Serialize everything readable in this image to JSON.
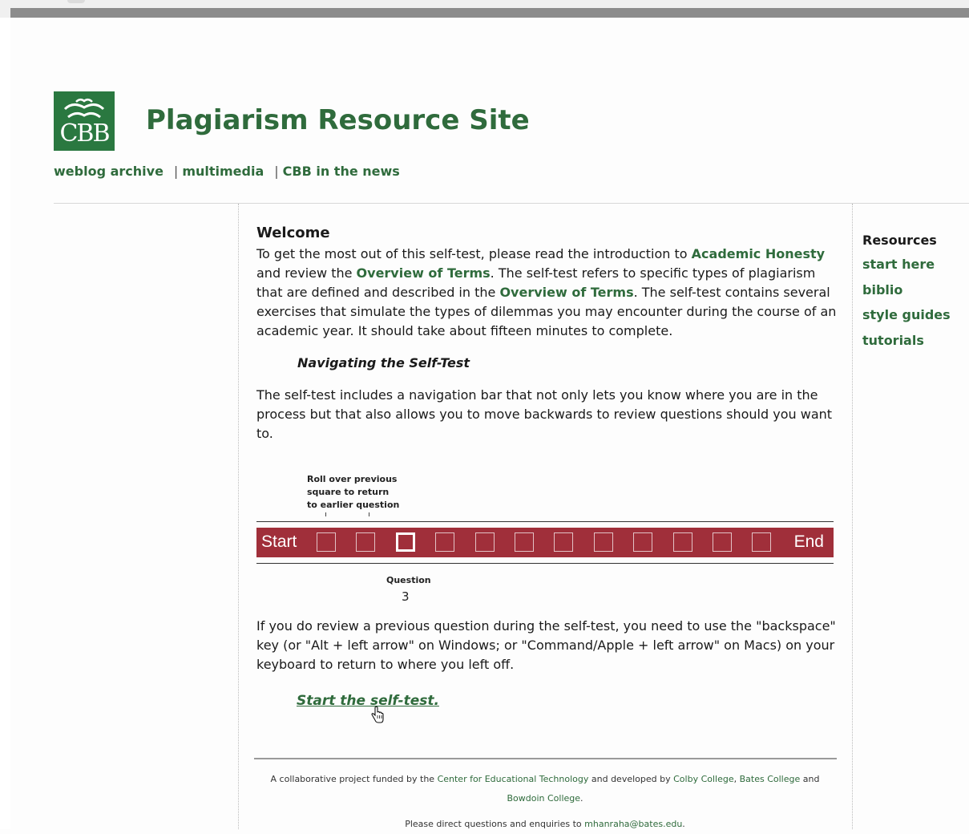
{
  "site": {
    "logo_text": "CBB",
    "title": "Plagiarism Resource Site",
    "nav": [
      "weblog archive",
      "multimedia",
      "CBB in the news"
    ],
    "nav_separator": "|"
  },
  "welcome": {
    "heading": "Welcome",
    "p1": {
      "t1": "To get the most out of this self-test, please read the introduction to ",
      "link1": "Academic Honesty",
      "t2": " and review the ",
      "link2": "Overview of Terms",
      "t3": ". The self-test refers to specific types of plagiarism that are defined and described in the ",
      "link3": "Overview of Terms",
      "t4": ". The self-test contains several exercises that simulate the types of dilemmas you may encounter during the course of an academic year. It should take about fifteen minutes to complete."
    },
    "subheading": "Navigating the Self-Test",
    "p2": "The self-test includes a navigation bar that not only lets you know where you are in the process but that also allows you to move backwards to review questions should you want to."
  },
  "diagram": {
    "callout_lines": [
      "Roll over previous",
      "square to return",
      "to earlier question"
    ],
    "start_label": "Start",
    "end_label": "End",
    "square_count": 12,
    "current_square": 3,
    "question_label": "Question",
    "question_number": "3"
  },
  "review": {
    "p3": "If you do review a previous question during the self-test, you need to use the \"backspace\" key (or \"Alt + left arrow\" on Windows; or \"Command/Apple + left arrow\" on Macs) on your keyboard to return to where you left off.",
    "start_link": "Start the self-test."
  },
  "footer": {
    "t1": "A collaborative project funded by the ",
    "link_cet": "Center for Educational Technology",
    "t2": " and developed by ",
    "link_colby": "Colby College",
    "t3": ", ",
    "link_bates": "Bates College",
    "t4": " and ",
    "link_bowdoin": "Bowdoin College",
    "t5": ".",
    "email_text": "Please direct questions and enquiries to ",
    "email": "mhanraha@bates.edu",
    "email_end": "."
  },
  "sidebar": {
    "heading": "Resources",
    "items": [
      "start here",
      "biblio",
      "style guides",
      "tutorials"
    ]
  },
  "colors": {
    "brand_green": "#2a7840",
    "link_green": "#2f6b3c",
    "navbar_red": "#a02f3a"
  }
}
